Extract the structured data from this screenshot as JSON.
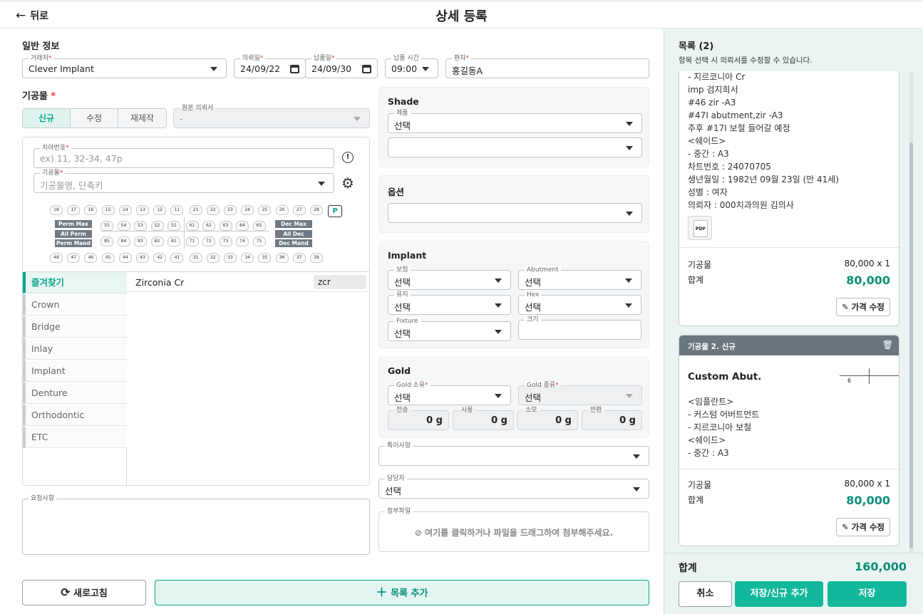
{
  "header": {
    "back_label": "뒤로",
    "title": "상세 등록"
  },
  "general": {
    "section_title": "일반 정보",
    "client": {
      "label": "거래처",
      "value": "Clever Implant"
    },
    "request_date": {
      "label": "의뢰일",
      "value": "24/09/22"
    },
    "delivery_date": {
      "label": "납품일",
      "value": "24/09/30"
    },
    "delivery_time": {
      "label": "납품 시간",
      "value": "09:00"
    },
    "patient": {
      "label": "환자",
      "value": "홍길동A"
    }
  },
  "prosthesis": {
    "section_title": "기공물",
    "tabs": [
      "신규",
      "수정",
      "재제작"
    ],
    "original_request": {
      "label": "원본 의뢰서",
      "value": "-"
    },
    "tooth_number": {
      "label": "치아번호",
      "placeholder": "ex) 11, 32-34, 47p"
    },
    "item": {
      "label": "기공물",
      "placeholder": "기공물명, 단축키"
    },
    "upper_teeth": [
      "18",
      "17",
      "16",
      "15",
      "14",
      "13",
      "12",
      "11",
      "21",
      "22",
      "23",
      "24",
      "25",
      "26",
      "27",
      "28"
    ],
    "upper_deciduous": [
      "55",
      "54",
      "53",
      "52",
      "51",
      "61",
      "62",
      "63",
      "64",
      "65"
    ],
    "lower_deciduous": [
      "85",
      "84",
      "83",
      "82",
      "81",
      "71",
      "72",
      "73",
      "74",
      "75"
    ],
    "lower_teeth": [
      "48",
      "47",
      "46",
      "45",
      "44",
      "43",
      "42",
      "41",
      "31",
      "32",
      "33",
      "34",
      "35",
      "36",
      "37",
      "38"
    ],
    "left_tags": [
      "Perm Max",
      "All Perm",
      "Perm Mand"
    ],
    "right_tags": [
      "Dec Max",
      "All Dec",
      "Dec Mand"
    ],
    "p_button": "P",
    "categories": [
      "즐겨찾기",
      "Crown",
      "Bridge",
      "Inlay",
      "Implant",
      "Denture",
      "Orthodontic",
      "ETC"
    ],
    "favorite": {
      "name": "Zirconia Cr",
      "shortcut": "zcr"
    },
    "notes_label": "요청사항"
  },
  "shade": {
    "title": "Shade",
    "product": {
      "label": "제품",
      "value": "선택"
    }
  },
  "options": {
    "title": "옵션"
  },
  "implant": {
    "title": "Implant",
    "insurance": {
      "label": "보험",
      "value": "선택"
    },
    "abutment": {
      "label": "Abutment",
      "value": "선택"
    },
    "retention": {
      "label": "유지",
      "value": "선택"
    },
    "hex": {
      "label": "Hex",
      "value": "선택"
    },
    "fixture": {
      "label": "Fixture",
      "value": "선택"
    },
    "size": {
      "label": "크기"
    }
  },
  "gold": {
    "title": "Gold",
    "ownership": {
      "label": "Gold 소유",
      "value": "선택"
    },
    "type": {
      "label": "Gold 종류",
      "value": "선택"
    },
    "amounts": [
      {
        "label": "전송",
        "value": "0 g"
      },
      {
        "label": "사용",
        "value": "0 g"
      },
      {
        "label": "소모",
        "value": "0 g"
      },
      {
        "label": "반환",
        "value": "0 g"
      }
    ]
  },
  "special": {
    "label": "특이사항"
  },
  "manager": {
    "label": "담당자",
    "value": "선택"
  },
  "attachment": {
    "label": "첨부파일",
    "hint": "여기를 클릭하거나 파일을 드래그하여 첨부해주세요."
  },
  "actions": {
    "refresh": "새로고침",
    "add_item": "목록 추가"
  },
  "list": {
    "title": "목록 (2)",
    "subtitle": "항목 선택 시 의뢰서를 수정할 수 있습니다.",
    "card1": {
      "lines": [
        "- 지르코니아 Cr",
        "imp 검지희서",
        "#46 zir -A3",
        "#47I abutment,zir -A3",
        "추후 #17I 보철 들어갈 예정",
        "<쉐이드>",
        "- 중간 : A3",
        "차트번호 : 24070705",
        "생년월일 : 1982년 09월 23일 (만 41세)",
        "성별 : 여자",
        "의뢰자 : 000치과의원   김의사"
      ],
      "pdf": "PDF",
      "item_label": "기공물",
      "item_price": "80,000 x 1",
      "total_label": "합계",
      "total": "80,000",
      "edit": "가격 수정"
    },
    "card2": {
      "header": "기공물 2.  신규",
      "name": "Custom Abut.",
      "tooth": "6",
      "lines": [
        "<임플란트>",
        "- 커스텀 어버트먼트",
        "- 지르코니아 보철",
        "<쉐이드>",
        "- 중간 : A3"
      ],
      "item_label": "기공물",
      "item_price": "80,000 x 1",
      "total_label": "합계",
      "total": "80,000",
      "edit": "가격 수정"
    },
    "grand_total_label": "합계",
    "grand_total": "160,000",
    "cancel": "취소",
    "save_new": "저장/신규 추가",
    "save": "저장"
  },
  "colors": {
    "accent": "#0aa58a",
    "accent_btn": "#12b89b",
    "right_bg": "#eaf4f2"
  }
}
